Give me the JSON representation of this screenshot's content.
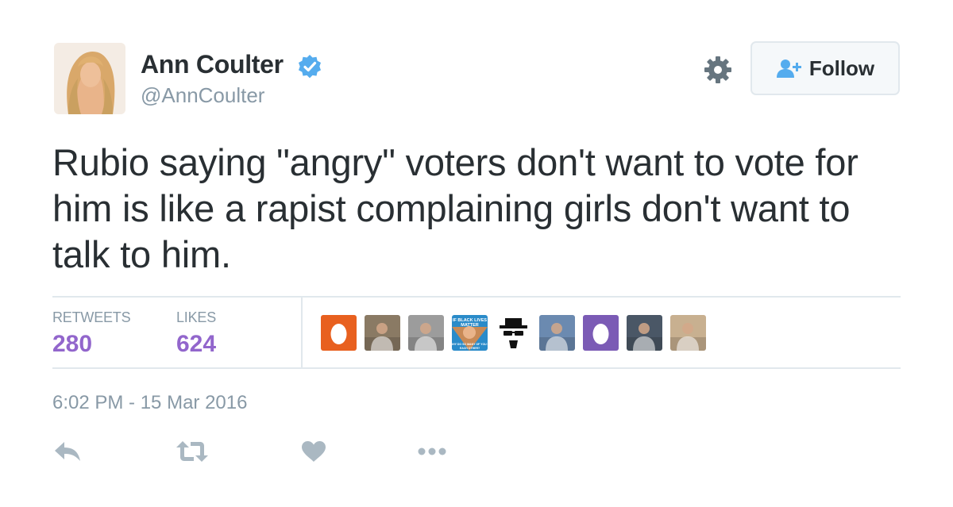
{
  "user": {
    "name": "Ann Coulter",
    "handle": "@AnnCoulter",
    "verified": true
  },
  "header": {
    "follow_label": "Follow",
    "settings_icon": "gear-icon",
    "follow_icon": "add-user-icon"
  },
  "tweet": {
    "text": "Rubio saying \"angry\" voters don't want to vote for him is like a rapist complaining girls don't want to talk to him.",
    "timestamp": "6:02 PM - 15 Mar 2016"
  },
  "stats": {
    "retweets_label": "RETWEETS",
    "retweets_value": "280",
    "likes_label": "LIKES",
    "likes_value": "624"
  },
  "likers": [
    {
      "kind": "egg",
      "color": "#e8601f"
    },
    {
      "kind": "photo",
      "color": "#8a7a64"
    },
    {
      "kind": "photo",
      "color": "#9c9c9c"
    },
    {
      "kind": "meme",
      "color": "#2a8bc9",
      "text_top": "IF BLACK LIVES MATTER",
      "text_bottom": "WHY DO SO MANY OF YOU K... EACH OTHER?"
    },
    {
      "kind": "heisenberg",
      "color": "#111111"
    },
    {
      "kind": "photo",
      "color": "#6b8ab0"
    },
    {
      "kind": "egg",
      "color": "#7b5bb5"
    },
    {
      "kind": "photo",
      "color": "#4a5766"
    },
    {
      "kind": "photo",
      "color": "#c8b090"
    }
  ],
  "actions": {
    "reply_icon": "reply-icon",
    "retweet_icon": "retweet-icon",
    "like_icon": "heart-icon",
    "more_icon": "more-icon"
  },
  "colors": {
    "text": "#292f33",
    "muted": "#8899a6",
    "stat_value": "#9266cc",
    "verified": "#55acee",
    "action_icon": "#aab8c2",
    "divider": "#e1e8ed"
  }
}
